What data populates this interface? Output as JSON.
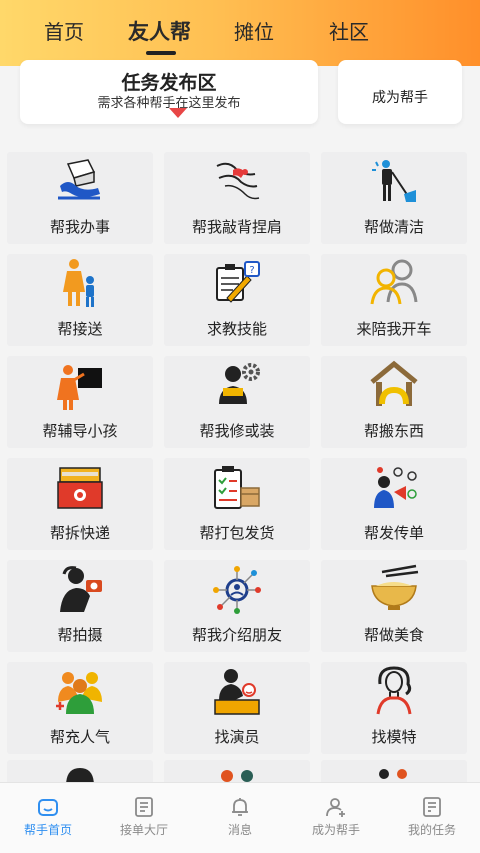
{
  "top_tabs": [
    "首页",
    "友人帮",
    "摊位",
    "社区"
  ],
  "active_tab": "友人帮",
  "header": {
    "title": "任务发布区",
    "subtitle": "需求各种帮手在这里发布",
    "become_helper": "成为帮手"
  },
  "services": [
    {
      "label": "帮我办事",
      "icon": "errand-icon"
    },
    {
      "label": "帮我敲背捏肩",
      "icon": "massage-icon"
    },
    {
      "label": "帮做清洁",
      "icon": "cleaning-icon"
    },
    {
      "label": "帮接送",
      "icon": "pickup-icon"
    },
    {
      "label": "求教技能",
      "icon": "skill-icon"
    },
    {
      "label": "来陪我开车",
      "icon": "driving-companion-icon"
    },
    {
      "label": "帮辅导小孩",
      "icon": "tutoring-icon"
    },
    {
      "label": "帮我修或装",
      "icon": "repair-icon"
    },
    {
      "label": "帮搬东西",
      "icon": "moving-icon"
    },
    {
      "label": "帮拆快递",
      "icon": "parcel-icon"
    },
    {
      "label": "帮打包发货",
      "icon": "packing-icon"
    },
    {
      "label": "帮发传单",
      "icon": "flyer-icon"
    },
    {
      "label": "帮拍摄",
      "icon": "camera-icon"
    },
    {
      "label": "帮我介绍朋友",
      "icon": "network-icon"
    },
    {
      "label": "帮做美食",
      "icon": "food-icon"
    },
    {
      "label": "帮充人气",
      "icon": "crowd-icon"
    },
    {
      "label": "找演员",
      "icon": "actor-icon"
    },
    {
      "label": "找模特",
      "icon": "model-icon"
    }
  ],
  "bottom_nav": [
    {
      "label": "帮手首页",
      "icon": "home-icon",
      "active": true
    },
    {
      "label": "接单大厅",
      "icon": "order-hall-icon",
      "active": false
    },
    {
      "label": "消息",
      "icon": "bell-icon",
      "active": false
    },
    {
      "label": "成为帮手",
      "icon": "add-user-icon",
      "active": false
    },
    {
      "label": "我的任务",
      "icon": "task-icon",
      "active": false
    }
  ],
  "colors": {
    "header_gradient_start": "#ffd86a",
    "header_gradient_end": "#ff8f2a",
    "accent_blue": "#2f8ff0",
    "arrow_red": "#e84646",
    "tile_bg": "#eeeeef"
  }
}
